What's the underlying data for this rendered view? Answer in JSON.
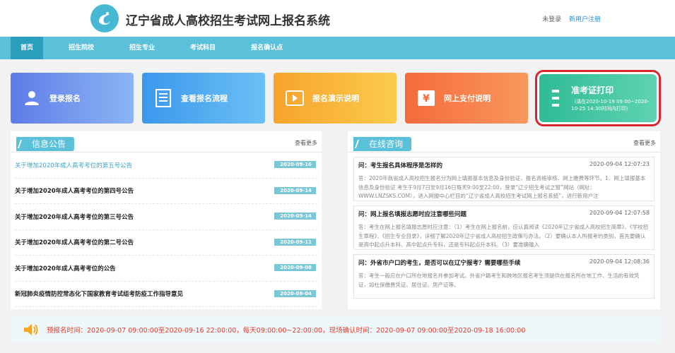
{
  "header": {
    "site_title": "辽宁省成人高校招生考试网上报名系统",
    "login_status": "未登录",
    "register_link": "新用户注册"
  },
  "nav": [
    {
      "label": "首页",
      "active": true
    },
    {
      "label": "招生院校"
    },
    {
      "label": "招生专业"
    },
    {
      "label": "考试科目"
    },
    {
      "label": "报名确认点"
    }
  ],
  "cards": [
    {
      "label": "登录报名",
      "icon": "user-icon"
    },
    {
      "label": "查看报名流程",
      "icon": "document-icon"
    },
    {
      "label": "报名演示说明",
      "icon": "video-icon"
    },
    {
      "label": "网上支付说明",
      "icon": "yuan-icon"
    },
    {
      "label": "准考证打印",
      "sub": "（请在2020-10-19 09:00~2020-10-25 14:30时间内打印）",
      "icon": "print-icon"
    }
  ],
  "announcements": {
    "title": "信息公告",
    "more": "查看更多",
    "items": [
      {
        "text": "关于增加2020年成人高考考位的第五号公告",
        "date": "2020-09-16"
      },
      {
        "text": "关于增加2020年成人高考考位的第四号公告",
        "date": "2020-09-14"
      },
      {
        "text": "关于增加2020年成人高考考位的第三号公告",
        "date": "2020-09-14"
      },
      {
        "text": "关于增加2020年成人高考考位的第二号公告",
        "date": "2020-09-11"
      },
      {
        "text": "关于增加2020年成人高考考位的公告",
        "date": "2020-09-08"
      },
      {
        "text": "新冠肺炎疫情防控常态化下国家教育考试组考防疫工作指导意见",
        "date": "2020-09-04"
      }
    ]
  },
  "consult": {
    "title": "在线咨询",
    "more": "查看更多",
    "items": [
      {
        "q": "问：考生报名具体程序是怎样的",
        "time": "2020-09-04 12:07:23",
        "a": "答：2020年我省成人高校招生报名分为网上填报基本信息及身份验证、报名资格审核、网上缴费等环节。1、网上填报基本信息及身份验证 考生于9月7日至9月16日每天9:00至22:00，登录“辽宁招生考试之窗”网站（网址：WWW.LNZSKS.COM），进入网报中心栏目的“辽宁省成人高校招生考试网上报名系统”，进行新用户注"
      },
      {
        "q": "问：网上报名填报志愿时应注意哪些问题",
        "time": "2020-09-04 12:07:58",
        "a": "答：考生在网上报名填报志愿时应注意：（1）考生在网上报名前，应认真阅读《2020年辽宁省成人高校招生简章》、《学校招生章程》、《招生专业目录》，详细了解2020年辽宁省成人高校招生政策与办法。（2）要确认本人所报考的类别，首先要确认是高中起点升本科、高中起点升专科，还是专科起点升本科。（3）要准确输入"
      },
      {
        "q": "问：外省市户口的考生，是否可以在辽宁报考？需要哪些手续",
        "time": "2020-09-04 12:08:36",
        "a": "答：考生一般应在户口所在地报名并参加考试。外省户籍考生和跨地区报名考生须提供在报名所在地工作、生活的有效凭证，如社保缴费凭证、居住证、房产证等。"
      }
    ]
  },
  "notice_bar": {
    "text": "预报名时间：2020-09-07 09:00:00至2020-09-16 22:00:00，每天09:00:00~22:00:00，现场确认时间：2020-09-07 09:00:00至2020-09-18 16:00:00"
  }
}
